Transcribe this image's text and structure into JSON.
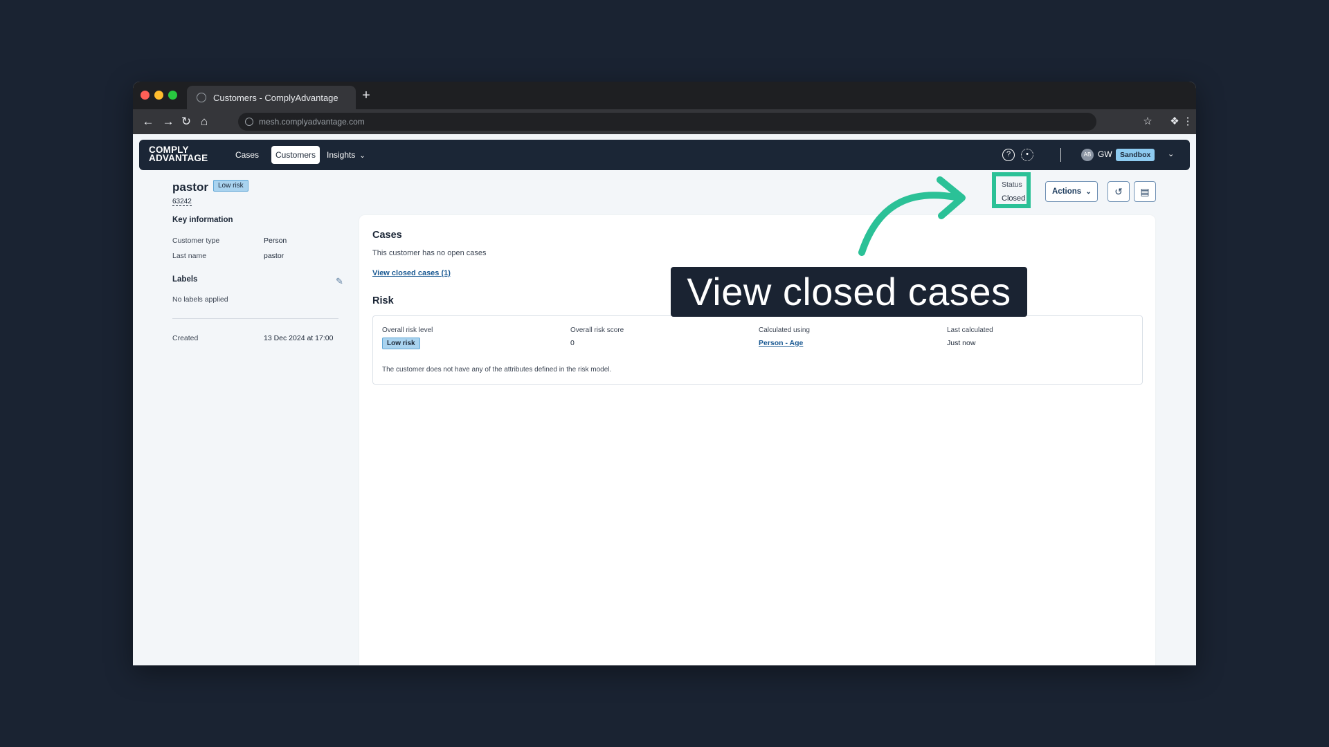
{
  "browser": {
    "tab_title": "Customers - ComplyAdvantage",
    "url": "mesh.complyadvantage.com"
  },
  "nav": {
    "logo_line1": "COMPLY",
    "logo_line2": "ADVANTAGE",
    "items": [
      {
        "label": "Cases"
      },
      {
        "label": "Customers"
      },
      {
        "label": "Insights"
      }
    ],
    "avatar_initials": "AB",
    "user_initials": "GW",
    "environment": "Sandbox"
  },
  "customer": {
    "name": "pastor",
    "risk_badge": "Low risk",
    "id": "63242",
    "key_info_heading": "Key information",
    "fields": [
      {
        "key": "Customer type",
        "value": "Person"
      },
      {
        "key": "Last name",
        "value": "pastor"
      }
    ],
    "labels_heading": "Labels",
    "labels_empty": "No labels applied",
    "created_key": "Created",
    "created_value": "13 Dec 2024 at 17:00"
  },
  "status": {
    "label": "Status",
    "value": "Closed"
  },
  "actions_label": "Actions",
  "cases": {
    "heading": "Cases",
    "empty_text": "This customer has no open cases",
    "closed_link": "View closed cases (1)"
  },
  "risk": {
    "heading": "Risk",
    "level_label": "Overall risk level",
    "level_value": "Low risk",
    "score_label": "Overall risk score",
    "score_value": "0",
    "calc_label": "Calculated using",
    "calc_value": "Person - Age",
    "last_label": "Last calculated",
    "last_value": "Just now",
    "note": "The customer does not have any of the attributes defined in the risk model."
  },
  "annotation": {
    "text": "View closed cases",
    "highlight_color": "#2bc197"
  },
  "colors": {
    "background": "#1a2332",
    "nav": "#1b2636",
    "link": "#1b5a93",
    "badge": "#a9d3ef"
  },
  "icons": [
    "back-icon",
    "forward-icon",
    "reload-icon",
    "home-icon",
    "star-icon",
    "extensions-icon",
    "menu-icon",
    "help-icon",
    "settings-icon",
    "pencil-icon",
    "history-icon",
    "comment-icon",
    "chevron-down-icon"
  ]
}
